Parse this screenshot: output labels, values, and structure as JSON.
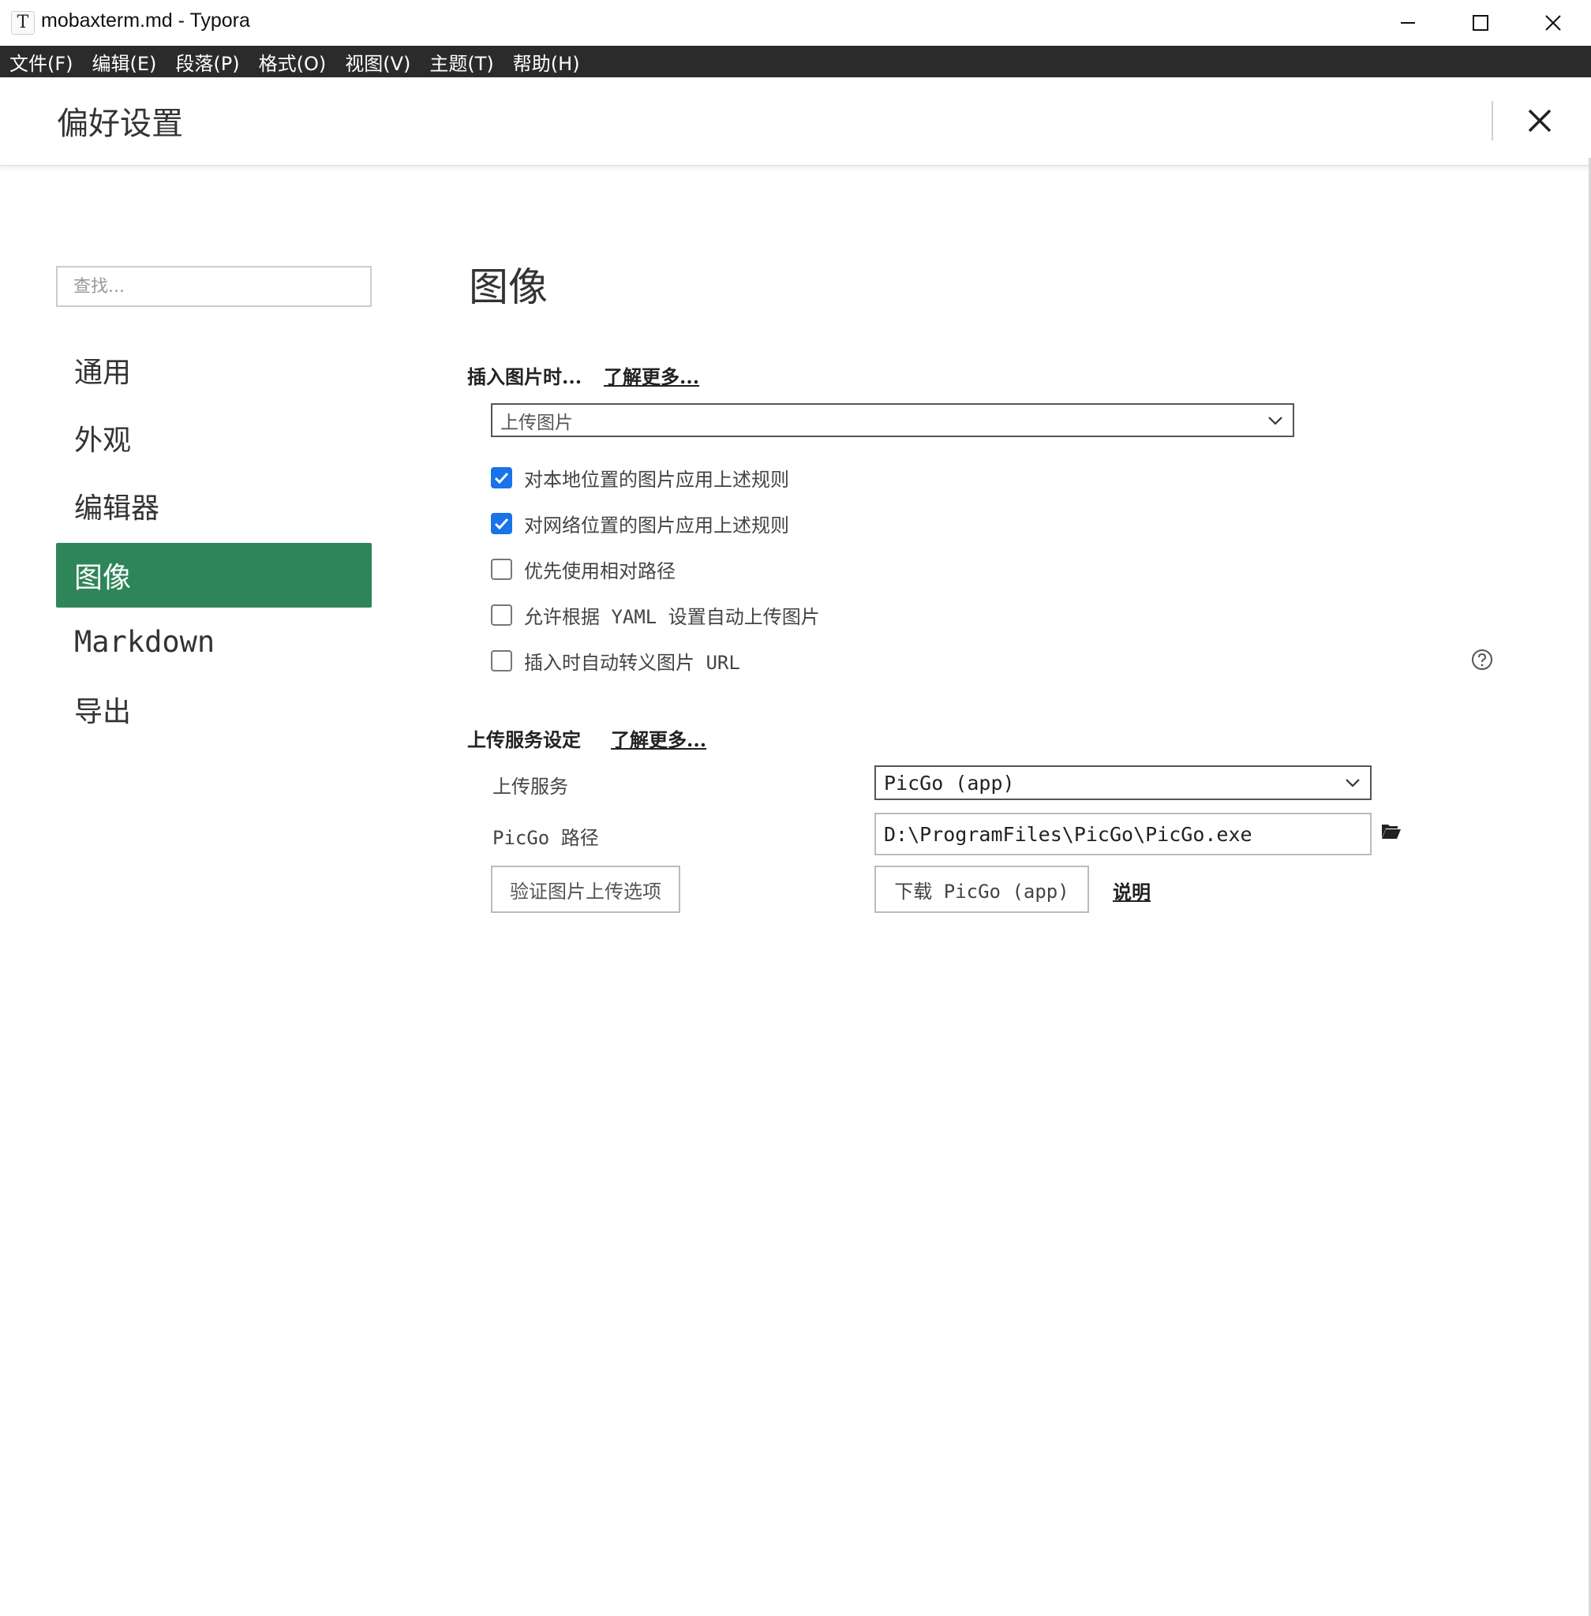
{
  "window": {
    "title": "mobaxterm.md - Typora",
    "app_icon_glyph": "T"
  },
  "menu": {
    "items": [
      "文件(F)",
      "编辑(E)",
      "段落(P)",
      "格式(O)",
      "视图(V)",
      "主题(T)",
      "帮助(H)"
    ]
  },
  "preferences": {
    "title": "偏好设置"
  },
  "sidebar": {
    "search_placeholder": "查找...",
    "items": [
      {
        "label": "通用",
        "active": false
      },
      {
        "label": "外观",
        "active": false
      },
      {
        "label": "编辑器",
        "active": false
      },
      {
        "label": "图像",
        "active": true
      },
      {
        "label": "Markdown",
        "active": false
      },
      {
        "label": "导出",
        "active": false
      }
    ]
  },
  "main": {
    "section_title": "图像",
    "insert": {
      "label": "插入图片时...",
      "learn_more": "了解更多...",
      "select_value": "上传图片",
      "options": [
        {
          "label": "对本地位置的图片应用上述规则",
          "checked": true
        },
        {
          "label": "对网络位置的图片应用上述规则",
          "checked": true
        },
        {
          "label": "优先使用相对路径",
          "checked": false
        },
        {
          "label": "允许根据 YAML 设置自动上传图片",
          "checked": false
        },
        {
          "label": "插入时自动转义图片 URL",
          "checked": false
        }
      ]
    },
    "upload": {
      "label": "上传服务设定",
      "learn_more": "了解更多...",
      "service_label": "上传服务",
      "service_value": "PicGo (app)",
      "path_label": "PicGo 路径",
      "path_value": "D:\\ProgramFiles\\PicGo\\PicGo.exe",
      "verify_button": "验证图片上传选项",
      "download_button": "下载 PicGo (app)",
      "help_link": "说明"
    }
  },
  "colors": {
    "menu_bar": "#2b2b2b",
    "active_nav": "#2f855a",
    "checkbox_checked": "#1a73e8"
  },
  "icons": {
    "minimize": "minimize-icon",
    "maximize": "maximize-icon",
    "close": "close-icon",
    "help": "question-circle-icon",
    "folder": "folder-open-icon",
    "chevron": "chevron-down-icon"
  }
}
